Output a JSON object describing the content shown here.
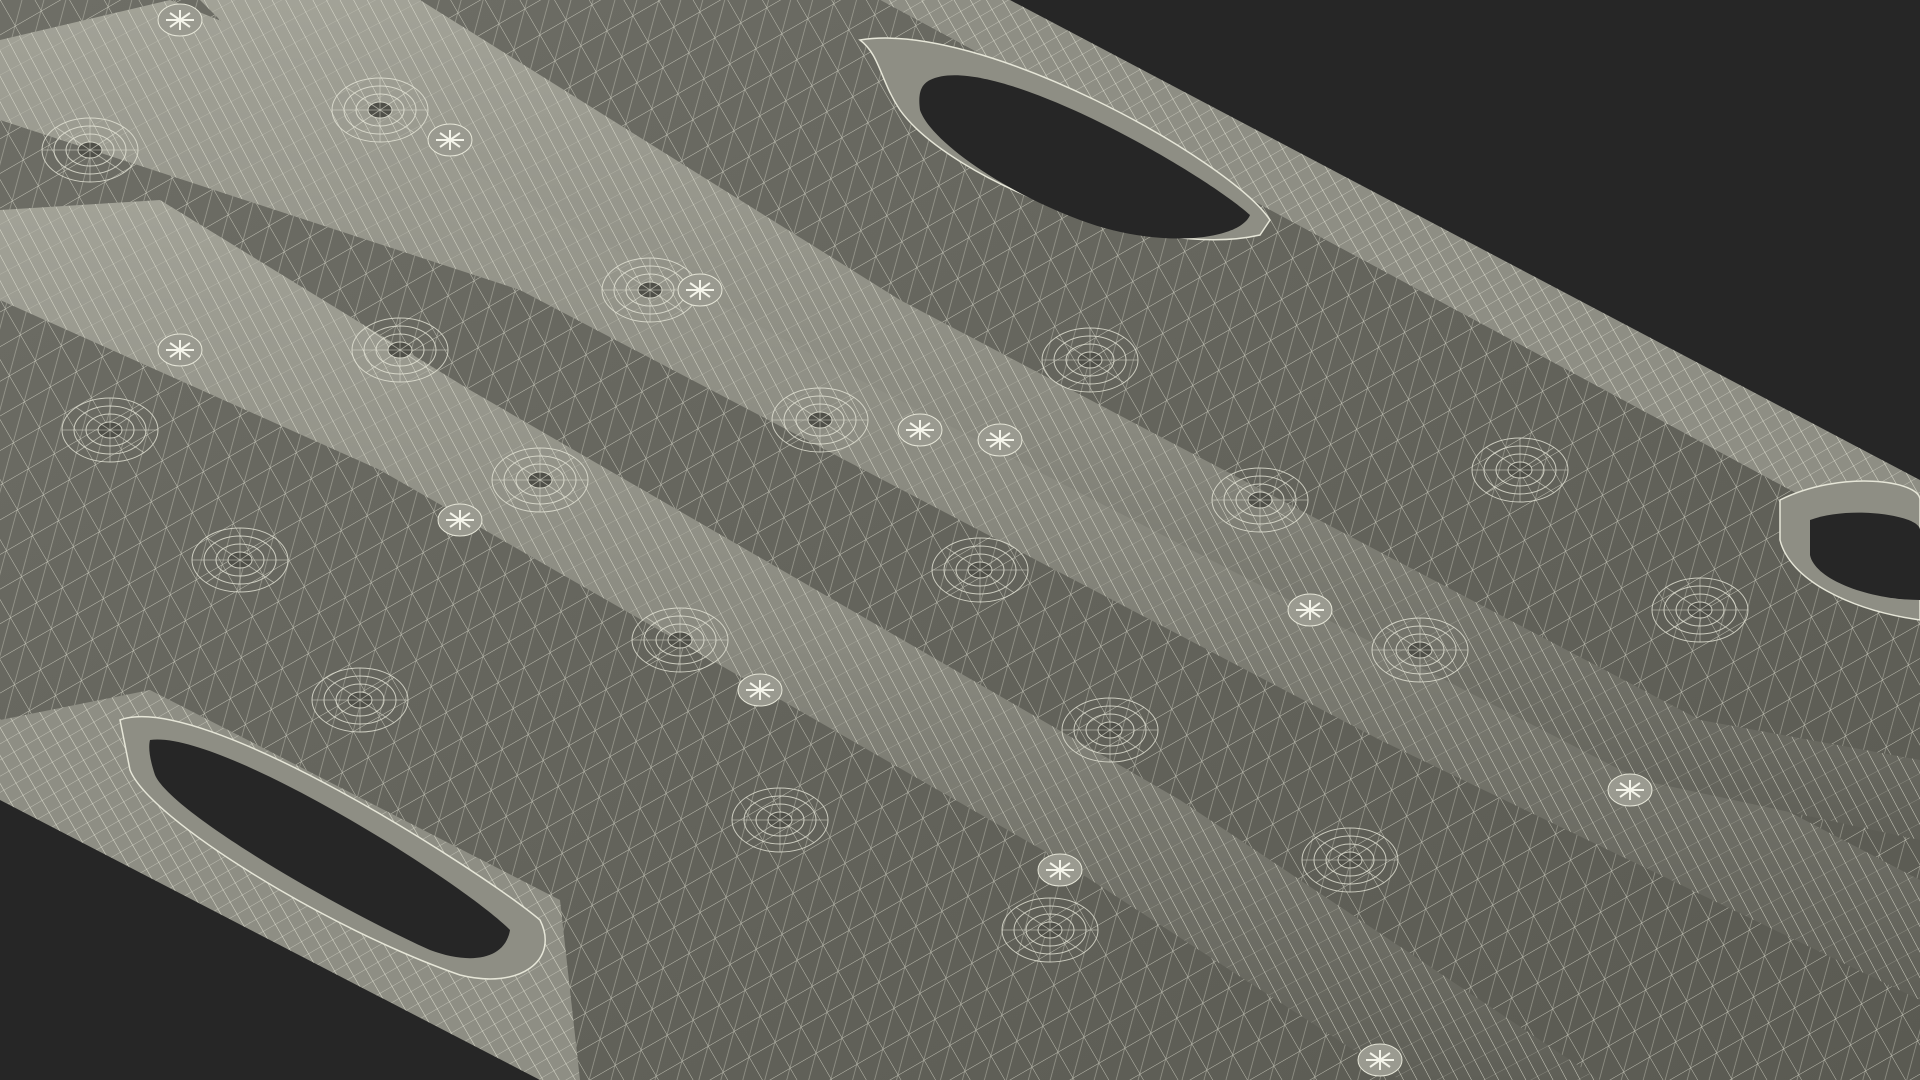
{
  "scene": {
    "subject": "wireframe-3d-model",
    "colors": {
      "background": "#262626",
      "surface": "#7d7d73",
      "surface_light": "#96968c",
      "surface_dark": "#55554d",
      "wire": "#e6e6d8",
      "hole": "#262626"
    },
    "features": {
      "ridges": 3,
      "handle_slots": 3,
      "crosshair_markers": 12,
      "round_sockets": 20
    }
  }
}
